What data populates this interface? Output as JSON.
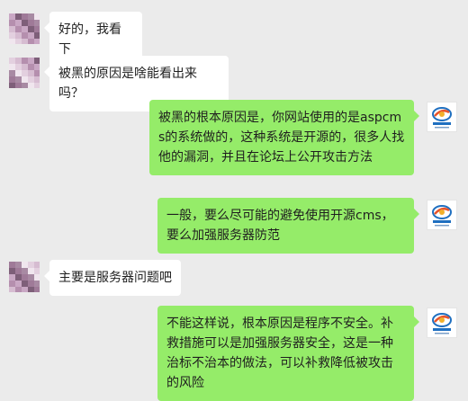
{
  "messages": [
    {
      "side": "left",
      "text": "好的，我看下"
    },
    {
      "side": "left",
      "text": "被黑的原因是啥能看出来吗？"
    },
    {
      "side": "right",
      "text": "被黑的根本原因是，你网站使用的是aspcms的系统做的，这种系统是开源的，很多人找他的漏洞，并且在论坛上公开攻击方法"
    },
    {
      "side": "right",
      "text": "一般，要么尽可能的避免使用开源cms，要么加强服务器防范"
    },
    {
      "side": "left",
      "text": "主要是服务器问题吧"
    },
    {
      "side": "right",
      "text": "不能这样说，根本原因是程序不安全。补救措施可以是加强服务器安全，这是一种治标不治本的做法，可以补救降低被攻击的风险"
    }
  ],
  "colors": {
    "background": "#ebebeb",
    "incoming_bubble": "#ffffff",
    "outgoing_bubble": "#95ec69"
  },
  "icons": {
    "contact_avatar": "pixelated-avatar",
    "agent_avatar": "company-logo-avatar"
  }
}
